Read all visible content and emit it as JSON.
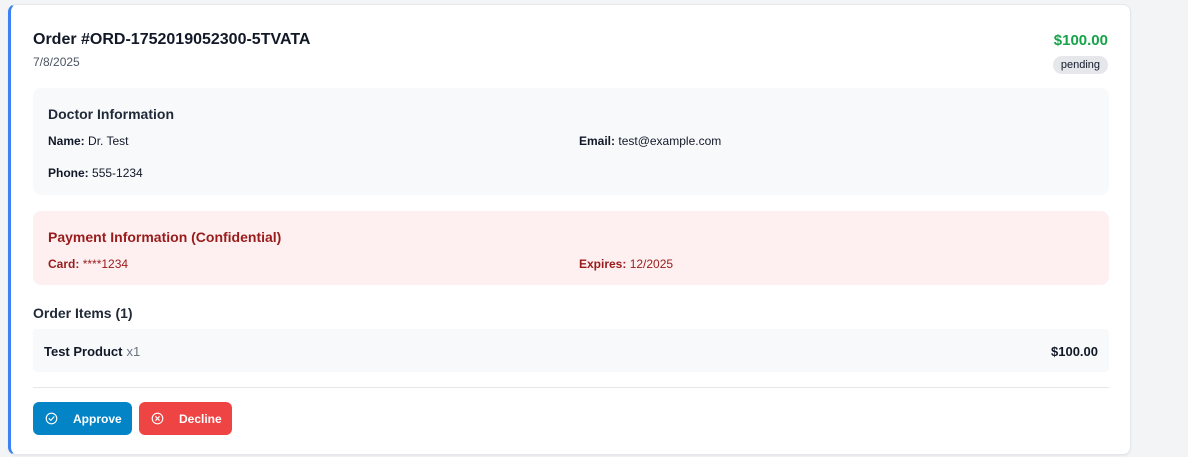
{
  "order": {
    "title": "Order #ORD-1752019052300-5TVATA",
    "date": "7/8/2025",
    "amount": "$100.00",
    "status": "pending"
  },
  "doctor": {
    "title": "Doctor Information",
    "name_label": "Name:",
    "name_value": "Dr. Test",
    "email_label": "Email:",
    "email_value": "test@example.com",
    "phone_label": "Phone:",
    "phone_value": "555-1234"
  },
  "payment": {
    "title": "Payment Information (Confidential)",
    "card_label": "Card:",
    "card_value": "****1234",
    "expires_label": "Expires:",
    "expires_value": "12/2025"
  },
  "items": {
    "title": "Order Items (1)",
    "list": [
      {
        "name": "Test Product",
        "qty": "x1",
        "price": "$100.00"
      }
    ]
  },
  "actions": {
    "approve_label": "Approve",
    "approve_icon": "check-circle-icon",
    "decline_label": "Decline",
    "decline_icon": "x-circle-icon"
  },
  "colors": {
    "accent_border": "#3b82f6",
    "amount_green": "#16a34a",
    "approve_bg": "#0284c7",
    "decline_bg": "#ef4444",
    "payment_bg": "#fef0f0",
    "payment_text": "#991b1b"
  }
}
